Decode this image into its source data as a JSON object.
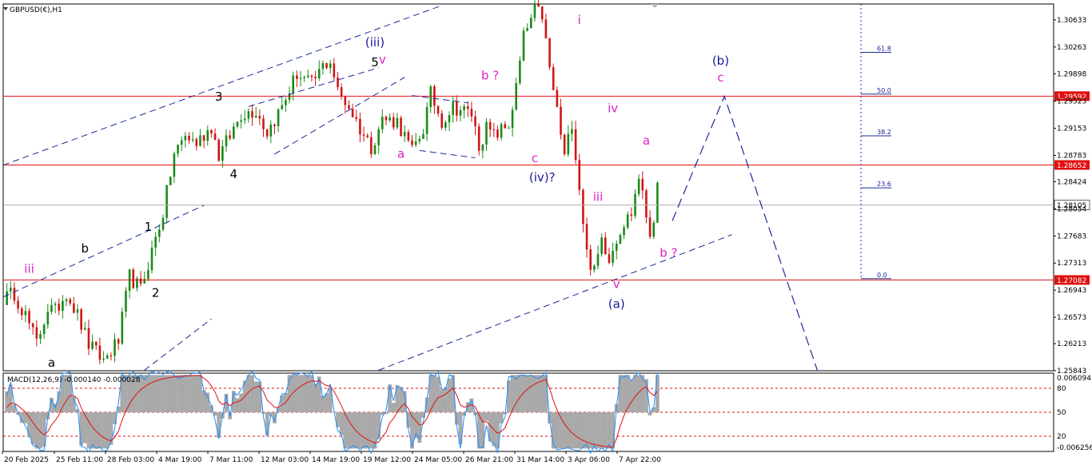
{
  "header": {
    "symbol_label": "GBPUSD(€),H1",
    "macd_label": "MACD(12,26,9) -0.000140 -0.000028"
  },
  "colors": {
    "up_candle": "#1a8a1a",
    "down_candle": "#d01515",
    "horizontal_line": "#e01010",
    "current_price_line": "#b0b0b0",
    "wave_blue": "#1a1a9a",
    "wave_magenta": "#e020c8",
    "wave_black": "#000000",
    "trendline": "#1a2a9a",
    "macd_histogram": "#a9a9a9",
    "macd_main": "#1e90ff",
    "macd_signal": "#e01010",
    "level_dotted": "#e01010"
  },
  "chart_data": {
    "type": "candlestick",
    "symbol": "GBPUSD",
    "timeframe": "H1",
    "ylim": [
      1.25843,
      1.3085
    ],
    "price_ticks": [
      "1.30633",
      "1.30263",
      "1.29898",
      "1.29523",
      "1.29153",
      "1.28783",
      "1.28424",
      "1.28054",
      "1.27683",
      "1.27313",
      "1.26943",
      "1.26573",
      "1.26213",
      "1.25843"
    ],
    "time_ticks": [
      "20 Feb 2025",
      "25 Feb 11:00",
      "28 Feb 03:00",
      "4 Mar 19:00",
      "7 Mar 11:00",
      "12 Mar 03:00",
      "14 Mar 19:00",
      "19 Mar 12:00",
      "24 Mar 05:00",
      "26 Mar 21:00",
      "31 Mar 14:00",
      "3 Apr 06:00",
      "7 Apr 22:00"
    ],
    "price_anchors": [
      {
        "t": 0,
        "p": 1.2683
      },
      {
        "t": 3,
        "p": 1.269
      },
      {
        "t": 6,
        "p": 1.266
      },
      {
        "t": 9,
        "p": 1.2622
      },
      {
        "t": 12,
        "p": 1.267
      },
      {
        "t": 14,
        "p": 1.2665
      },
      {
        "t": 17,
        "p": 1.2692
      },
      {
        "t": 20,
        "p": 1.266
      },
      {
        "t": 23,
        "p": 1.262
      },
      {
        "t": 27,
        "p": 1.2598
      },
      {
        "t": 31,
        "p": 1.2625
      },
      {
        "t": 34,
        "p": 1.2713
      },
      {
        "t": 37,
        "p": 1.2695
      },
      {
        "t": 40,
        "p": 1.2748
      },
      {
        "t": 43,
        "p": 1.28
      },
      {
        "t": 46,
        "p": 1.288
      },
      {
        "t": 49,
        "p": 1.2905
      },
      {
        "t": 52,
        "p": 1.2895
      },
      {
        "t": 56,
        "p": 1.2918
      },
      {
        "t": 58,
        "p": 1.2878
      },
      {
        "t": 61,
        "p": 1.2905
      },
      {
        "t": 64,
        "p": 1.2935
      },
      {
        "t": 68,
        "p": 1.294
      },
      {
        "t": 71,
        "p": 1.291
      },
      {
        "t": 75,
        "p": 1.2945
      },
      {
        "t": 79,
        "p": 1.299
      },
      {
        "t": 83,
        "p": 1.2975
      },
      {
        "t": 86,
        "p": 1.3
      },
      {
        "t": 88,
        "p": 1.3008
      },
      {
        "t": 90,
        "p": 1.2965
      },
      {
        "t": 93,
        "p": 1.2945
      },
      {
        "t": 96,
        "p": 1.2915
      },
      {
        "t": 99,
        "p": 1.289
      },
      {
        "t": 102,
        "p": 1.2928
      },
      {
        "t": 106,
        "p": 1.2925
      },
      {
        "t": 110,
        "p": 1.2883
      },
      {
        "t": 113,
        "p": 1.2915
      },
      {
        "t": 115,
        "p": 1.2962
      },
      {
        "t": 118,
        "p": 1.2925
      },
      {
        "t": 121,
        "p": 1.2945
      },
      {
        "t": 126,
        "p": 1.2935
      },
      {
        "t": 128,
        "p": 1.2892
      },
      {
        "t": 130,
        "p": 1.2915
      },
      {
        "t": 132,
        "p": 1.2905
      },
      {
        "t": 136,
        "p": 1.292
      },
      {
        "t": 138,
        "p": 1.297
      },
      {
        "t": 140,
        "p": 1.304
      },
      {
        "t": 143,
        "p": 1.3075
      },
      {
        "t": 145,
        "p": 1.307
      },
      {
        "t": 147,
        "p": 1.2995
      },
      {
        "t": 149,
        "p": 1.294
      },
      {
        "t": 151,
        "p": 1.2875
      },
      {
        "t": 153,
        "p": 1.2925
      },
      {
        "t": 155,
        "p": 1.2835
      },
      {
        "t": 157,
        "p": 1.2745
      },
      {
        "t": 159,
        "p": 1.2718
      },
      {
        "t": 161,
        "p": 1.2765
      },
      {
        "t": 163,
        "p": 1.274
      },
      {
        "t": 166,
        "p": 1.2778
      },
      {
        "t": 169,
        "p": 1.28
      },
      {
        "t": 171,
        "p": 1.285
      },
      {
        "t": 172,
        "p": 1.2822
      },
      {
        "t": 174,
        "p": 1.2772
      },
      {
        "t": 175,
        "p": 1.2795
      },
      {
        "t": 176,
        "p": 1.283
      }
    ],
    "bars_total": 176,
    "bar_step_px": 4.65,
    "horizontal_lines": [
      {
        "price": 1.29592,
        "label": "1.29592",
        "style": "red"
      },
      {
        "price": 1.28652,
        "label": "1.28652",
        "style": "red"
      },
      {
        "price": 1.28105,
        "label": "1.28105",
        "style": "current"
      },
      {
        "price": 1.27082,
        "label": "1.27082",
        "style": "red"
      }
    ],
    "fibonacci": {
      "levels": [
        "61.8",
        "50.0",
        "38.2",
        "23.6",
        "0.0"
      ],
      "prices": [
        1.3019,
        1.2962,
        1.2905,
        1.2834,
        1.271
      ]
    },
    "wave_labels": [
      {
        "text": "(iii)",
        "bar": 100,
        "price": 1.3027,
        "color": "blue"
      },
      {
        "text": "5",
        "bar": 100,
        "price": 1.3,
        "color": "black"
      },
      {
        "text": "v",
        "bar": 102,
        "price": 1.3004,
        "color": "magenta"
      },
      {
        "text": "3",
        "bar": 58,
        "price": 1.2953,
        "color": "black"
      },
      {
        "text": "4",
        "bar": 62,
        "price": 1.2847,
        "color": "black"
      },
      {
        "text": "b ?",
        "bar": 131,
        "price": 1.2982,
        "color": "magenta"
      },
      {
        "text": "a",
        "bar": 107,
        "price": 1.2875,
        "color": "magenta"
      },
      {
        "text": "c",
        "bar": 143,
        "price": 1.2869,
        "color": "magenta"
      },
      {
        "text": "(iv)?",
        "bar": 145,
        "price": 1.2843,
        "color": "blue"
      },
      {
        "text": "i",
        "bar": 155,
        "price": 1.3058,
        "color": "magenta"
      },
      {
        "text": "iv",
        "bar": 164,
        "price": 1.2937,
        "color": "magenta"
      },
      {
        "text": "iii",
        "bar": 160,
        "price": 1.2816,
        "color": "magenta"
      },
      {
        "text": "a",
        "bar": 173,
        "price": 1.2893,
        "color": "magenta"
      },
      {
        "text": "b ?",
        "bar": 179,
        "price": 1.274,
        "color": "magenta"
      },
      {
        "text": "v",
        "bar": 165,
        "price": 1.2697,
        "color": "magenta"
      },
      {
        "text": "(a)",
        "bar": 165,
        "price": 1.267,
        "color": "blue"
      },
      {
        "text": "(b)",
        "bar": 193,
        "price": 1.3002,
        "color": "blue"
      },
      {
        "text": "c",
        "bar": 193,
        "price": 1.2979,
        "color": "magenta"
      },
      {
        "text": "iii",
        "bar": 7,
        "price": 1.2718,
        "color": "magenta"
      },
      {
        "text": "b",
        "bar": 22,
        "price": 1.2746,
        "color": "black"
      },
      {
        "text": "1",
        "bar": 39,
        "price": 1.2775,
        "color": "black"
      },
      {
        "text": "2",
        "bar": 41,
        "price": 1.2685,
        "color": "black"
      },
      {
        "text": "a",
        "bar": 13,
        "price": 1.259,
        "color": "black"
      }
    ],
    "projection_path": [
      {
        "bar": 180,
        "price": 1.2789
      },
      {
        "bar": 194,
        "price": 1.2959
      },
      {
        "bar": 219,
        "price": 1.2585
      }
    ],
    "macd": {
      "label_values": [
        "-0.000140",
        "-0.000028"
      ],
      "ticks": [
        "0.006094",
        "80",
        "50",
        "20",
        "-0.006256"
      ],
      "levels": [
        80,
        50,
        20
      ],
      "ylim": [
        -0.006256,
        0.006094
      ]
    }
  }
}
